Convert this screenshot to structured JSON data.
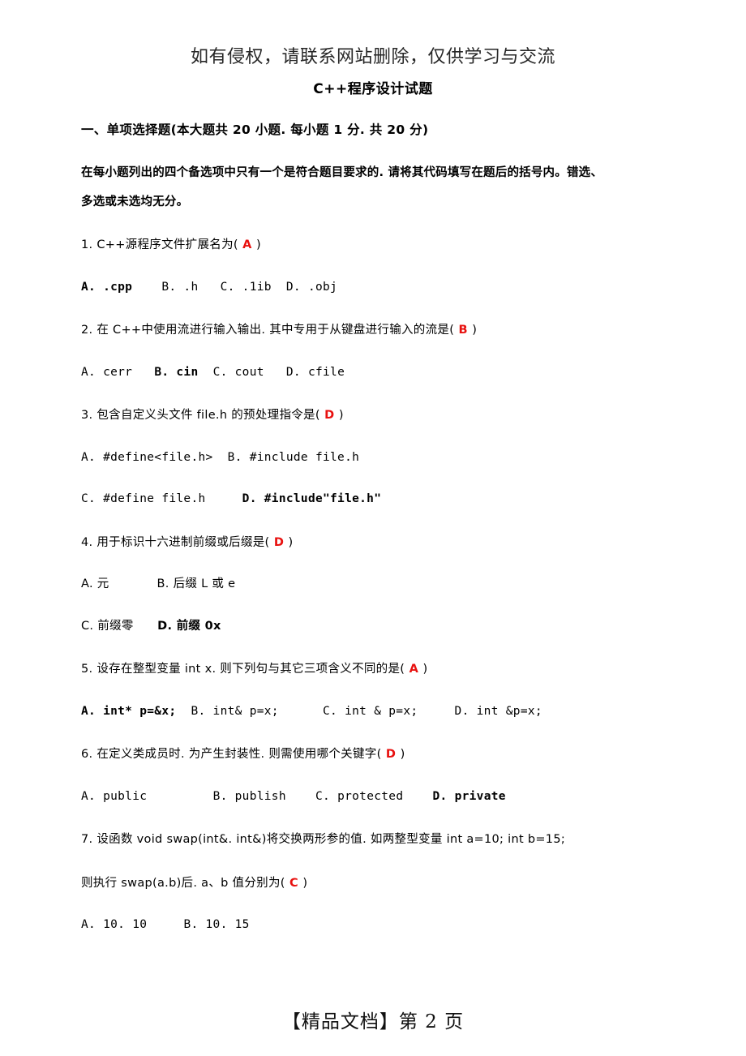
{
  "notice": "如有侵权，请联系网站删除，仅供学习与交流",
  "title": "C++程序设计试题",
  "section_heading": "一、单项选择题(本大题共 20 小题. 每小题 1 分. 共 20 分)",
  "instructions_line1": "在每小题列出的四个备选项中只有一个是符合题目要求的. 请将其代码填写在题后的括号内。错选、",
  "instructions_line2": "多选或未选均无分。",
  "questions": [
    {
      "stem_prefix": "1. C++源程序文件扩展名为(",
      "answer": "A",
      "stem_suffix": ")",
      "option_rows": [
        {
          "mono": true,
          "options": [
            {
              "text": "A. .cpp",
              "correct": true,
              "gap": "    "
            },
            {
              "text": "B. .h",
              "correct": false,
              "gap": "   "
            },
            {
              "text": "C. .1ib",
              "correct": false,
              "gap": "  "
            },
            {
              "text": "D. .obj",
              "correct": false,
              "gap": ""
            }
          ]
        }
      ]
    },
    {
      "stem_prefix": "2. 在 C++中使用流进行输入输出. 其中专用于从键盘进行输入的流是(",
      "answer": "B",
      "stem_suffix": ")",
      "option_rows": [
        {
          "mono": true,
          "options": [
            {
              "text": "A. cerr",
              "correct": false,
              "gap": "   "
            },
            {
              "text": "B. cin",
              "correct": true,
              "gap": "  "
            },
            {
              "text": "C. cout",
              "correct": false,
              "gap": "   "
            },
            {
              "text": "D. cfile",
              "correct": false,
              "gap": ""
            }
          ]
        }
      ]
    },
    {
      "stem_prefix": "3. 包含自定义头文件 file.h 的预处理指令是(",
      "answer": "D",
      "stem_suffix": ")",
      "option_rows": [
        {
          "mono": true,
          "options": [
            {
              "text": "A. #define<file.h>",
              "correct": false,
              "gap": "  "
            },
            {
              "text": "B. #include file.h",
              "correct": false,
              "gap": ""
            }
          ]
        },
        {
          "mono": true,
          "options": [
            {
              "text": "C. #define file.h",
              "correct": false,
              "gap": "     "
            },
            {
              "text": "D. #include\"file.h\"",
              "correct": true,
              "gap": ""
            }
          ]
        }
      ]
    },
    {
      "stem_prefix": "4. 用于标识十六进制前缀或后缀是(",
      "answer": "D",
      "stem_suffix": ")",
      "option_rows": [
        {
          "mono": false,
          "options": [
            {
              "text": "A. 元",
              "correct": false,
              "gap": "            "
            },
            {
              "text": "B. 后缀 L 或 e",
              "correct": false,
              "gap": ""
            }
          ]
        },
        {
          "mono": false,
          "options": [
            {
              "text": "C. 前缀零",
              "correct": false,
              "gap": "      "
            },
            {
              "text": "D. 前缀 0x",
              "correct": true,
              "gap": ""
            }
          ]
        }
      ]
    },
    {
      "stem_prefix": "5. 设存在整型变量 int x. 则下列句与其它三项含义不同的是(",
      "answer": "A",
      "stem_suffix": ")",
      "option_rows": [
        {
          "mono": true,
          "options": [
            {
              "text": "A. int* p=&x;",
              "correct": true,
              "gap": "  "
            },
            {
              "text": "B. int& p=x;",
              "correct": false,
              "gap": "      "
            },
            {
              "text": "C. int & p=x;",
              "correct": false,
              "gap": "     "
            },
            {
              "text": "D. int &p=x;",
              "correct": false,
              "gap": ""
            }
          ]
        }
      ]
    },
    {
      "stem_prefix": "6. 在定义类成员时. 为产生封装性. 则需使用哪个关键字(",
      "answer": "D",
      "stem_suffix": ")",
      "option_rows": [
        {
          "mono": true,
          "options": [
            {
              "text": "A. public",
              "correct": false,
              "gap": "         "
            },
            {
              "text": "B. publish",
              "correct": false,
              "gap": "    "
            },
            {
              "text": "C. protected",
              "correct": false,
              "gap": "    "
            },
            {
              "text": "D. private",
              "correct": true,
              "gap": ""
            }
          ]
        }
      ]
    },
    {
      "stem_prefix": "7. 设函数 void swap(int&. int&)将交换两形参的值. 如两整型变量 int a=10; int b=15;",
      "answer": "",
      "stem_suffix": "",
      "extra_stem_prefix": "则执行 swap(a.b)后. a、b 值分别为(",
      "extra_answer": "C",
      "extra_stem_suffix": ")",
      "option_rows": [
        {
          "mono": true,
          "options": [
            {
              "text": "A. 10. 10",
              "correct": false,
              "gap": "     "
            },
            {
              "text": "B. 10. 15",
              "correct": false,
              "gap": ""
            }
          ]
        }
      ]
    }
  ],
  "footer": "【精品文档】第 2 页"
}
